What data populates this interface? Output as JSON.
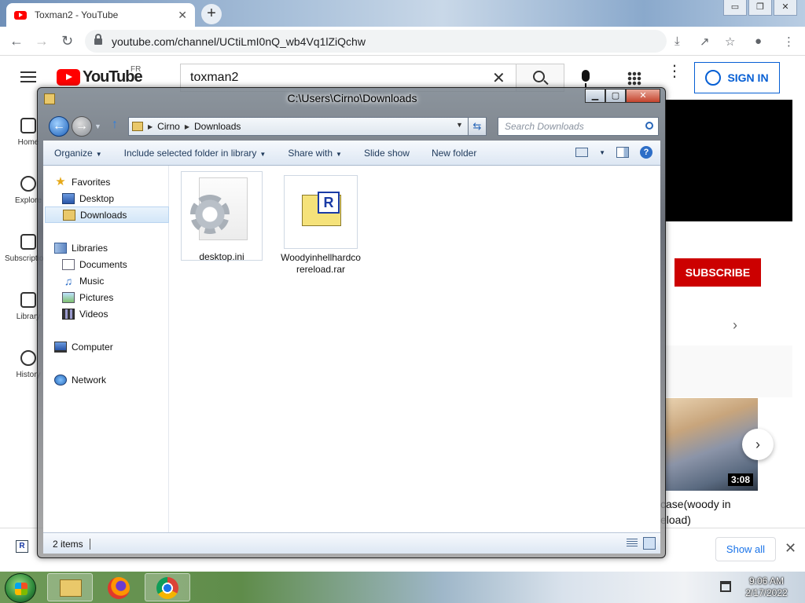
{
  "browser": {
    "tab_title": "Toxman2 - YouTube",
    "tab_close": "✕",
    "new_tab": "+",
    "url": "youtube.com/channel/UCtiLmI0nQ_wb4Vq1lZiQchw",
    "window_controls": [
      "▭",
      "❐",
      "✕"
    ]
  },
  "youtube": {
    "logo_text": "YouTube",
    "country": "FR",
    "search_value": "toxman2",
    "sign_in": "SIGN IN",
    "sidebar": [
      {
        "label": "Home",
        "icon": "home-icon"
      },
      {
        "label": "Explore",
        "icon": "compass-icon"
      },
      {
        "label": "Subscriptions",
        "icon": "subscriptions-icon"
      },
      {
        "label": "Library",
        "icon": "library-icon"
      },
      {
        "label": "History",
        "icon": "history-icon"
      }
    ],
    "subscribe": "SUBSCRIBE",
    "video_duration": "3:08",
    "video_title_line1": "case(woody in",
    "video_title_line2": "eload)",
    "show_all": "Show all"
  },
  "explorer": {
    "title": "C:\\Users\\Cirno\\Downloads",
    "breadcrumb": [
      "Cirno",
      "Downloads"
    ],
    "search_placeholder": "Search Downloads",
    "commands": {
      "organize": "Organize",
      "include": "Include selected folder in library",
      "share": "Share with",
      "slideshow": "Slide show",
      "new_folder": "New folder"
    },
    "nav": {
      "favorites": "Favorites",
      "desktop": "Desktop",
      "downloads": "Downloads",
      "libraries": "Libraries",
      "documents": "Documents",
      "music": "Music",
      "pictures": "Pictures",
      "videos": "Videos",
      "computer": "Computer",
      "network": "Network"
    },
    "files": [
      {
        "name": "desktop.ini"
      },
      {
        "name": "Woodyinhellhardcorereload.rar"
      }
    ],
    "status": "2 items"
  },
  "taskbar": {
    "time": "9:06 AM",
    "date": "2/17/2022"
  }
}
